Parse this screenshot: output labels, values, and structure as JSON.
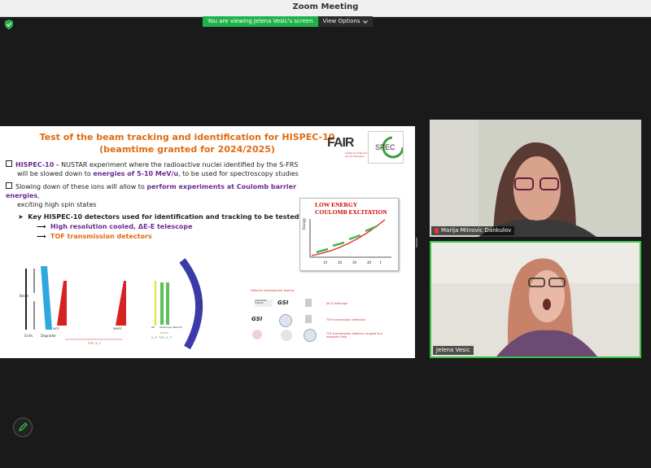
{
  "window": {
    "title": "Zoom Meeting"
  },
  "share_bar": {
    "viewing_text": "You are viewing Jelena Vesic's screen",
    "view_options_label": "View Options"
  },
  "slide": {
    "title_line1": "Test of  the beam tracking and identification for HISPEC-10",
    "title_line2": "(beamtime granted for 2024/2025)",
    "logo_fair": "FAIR",
    "logo_fair_sub": "Facility for Antiproton and Ion Research",
    "logo_spec": "SPEC",
    "bullet1_a": "HISPEC-10 - ",
    "bullet1_b": "NUSTAR experiment where the radioactive nuclei identified by the S-FRS",
    "bullet1_c": "will be slowed down to ",
    "bullet1_d": "energies of 5-10 MeV/u",
    "bullet1_e": ", to be used for spectroscopy studies",
    "bullet2_a": "Slowing down of these ions will allow to ",
    "bullet2_b": "perform experiments at Coulomb barrier energies",
    "bullet2_c": ",",
    "bullet2_d": "exciting high spin states",
    "key_text": "Key HISPEC-10 detectors used for identification and tracking to be tested:",
    "sub_item1": "High resolution cooled, ΔE-E telescope",
    "sub_item2": "TOF transmission detectors",
    "chart_title_1": "LOW ENERGY",
    "chart_title_2": "COULOMB EXCITATION",
    "chart_ylabel": "Energy",
    "chart_ticks": [
      "10",
      "20",
      "30",
      "40",
      "I"
    ],
    "setup_labels": {
      "beam": "Beam",
      "scint": "Scint.",
      "degrader": "Degrader",
      "mcp": "MCP",
      "mwpc": "MWPC",
      "tof": "TOF, X, Y",
      "ae": "ΔE",
      "telescope": "Telescope detector",
      "ae_e": "Δ, E, TOF, X, Y",
      "magnet": "Magnet"
    },
    "det_panel": {
      "header": "Detector development lead by:",
      "row1": "ΔE-E telescope",
      "row2": "TOF transmission detectors",
      "row3": "TOF   transmission   detector coupled to a magnetic field",
      "logo_jozef": "Jožef Stefan Institute",
      "logo_gsi": "GSI"
    }
  },
  "participants": [
    {
      "name": "Marija Mitrovic Dankulov",
      "muted": true
    },
    {
      "name": "Jelena Vesic",
      "muted": false
    }
  ],
  "colors": {
    "accent_orange": "#e06b10",
    "accent_purple": "#6a2c91",
    "share_green": "#20b34b",
    "speaker_border": "#3cc04a"
  }
}
